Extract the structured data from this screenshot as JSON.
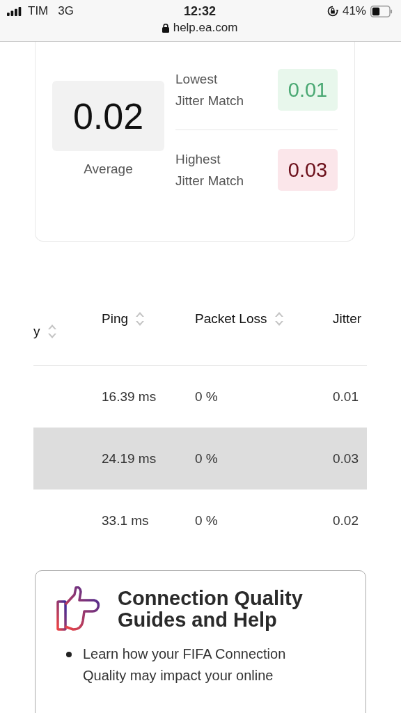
{
  "status_bar": {
    "carrier": "TIM",
    "network": "3G",
    "time": "12:32",
    "battery": "41%",
    "url": "help.ea.com"
  },
  "jitter_card": {
    "average": {
      "value": "0.02",
      "label": "Average"
    },
    "extremes": [
      {
        "label": "Lowest Jitter Match",
        "value": "0.01",
        "kind": "low"
      },
      {
        "label": "Highest Jitter Match",
        "value": "0.03",
        "kind": "high"
      }
    ]
  },
  "table": {
    "columns": [
      {
        "label": "y",
        "sortable": true
      },
      {
        "label": "Ping",
        "sortable": true
      },
      {
        "label": "Packet Loss",
        "sortable": true
      },
      {
        "label": "Jitter"
      }
    ],
    "rows": [
      {
        "selected": false,
        "cells": [
          "",
          "16.39 ms",
          "0 %",
          "0.01"
        ]
      },
      {
        "selected": true,
        "cells": [
          "",
          "24.19 ms",
          "0 %",
          "0.03"
        ]
      },
      {
        "selected": false,
        "cells": [
          "",
          "33.1 ms",
          "0 %",
          "0.02"
        ]
      }
    ]
  },
  "guide_card": {
    "title": "Connection Quality Guides and Help",
    "bullets": [
      "Learn how your FIFA Connection Quality may impact your online"
    ]
  }
}
